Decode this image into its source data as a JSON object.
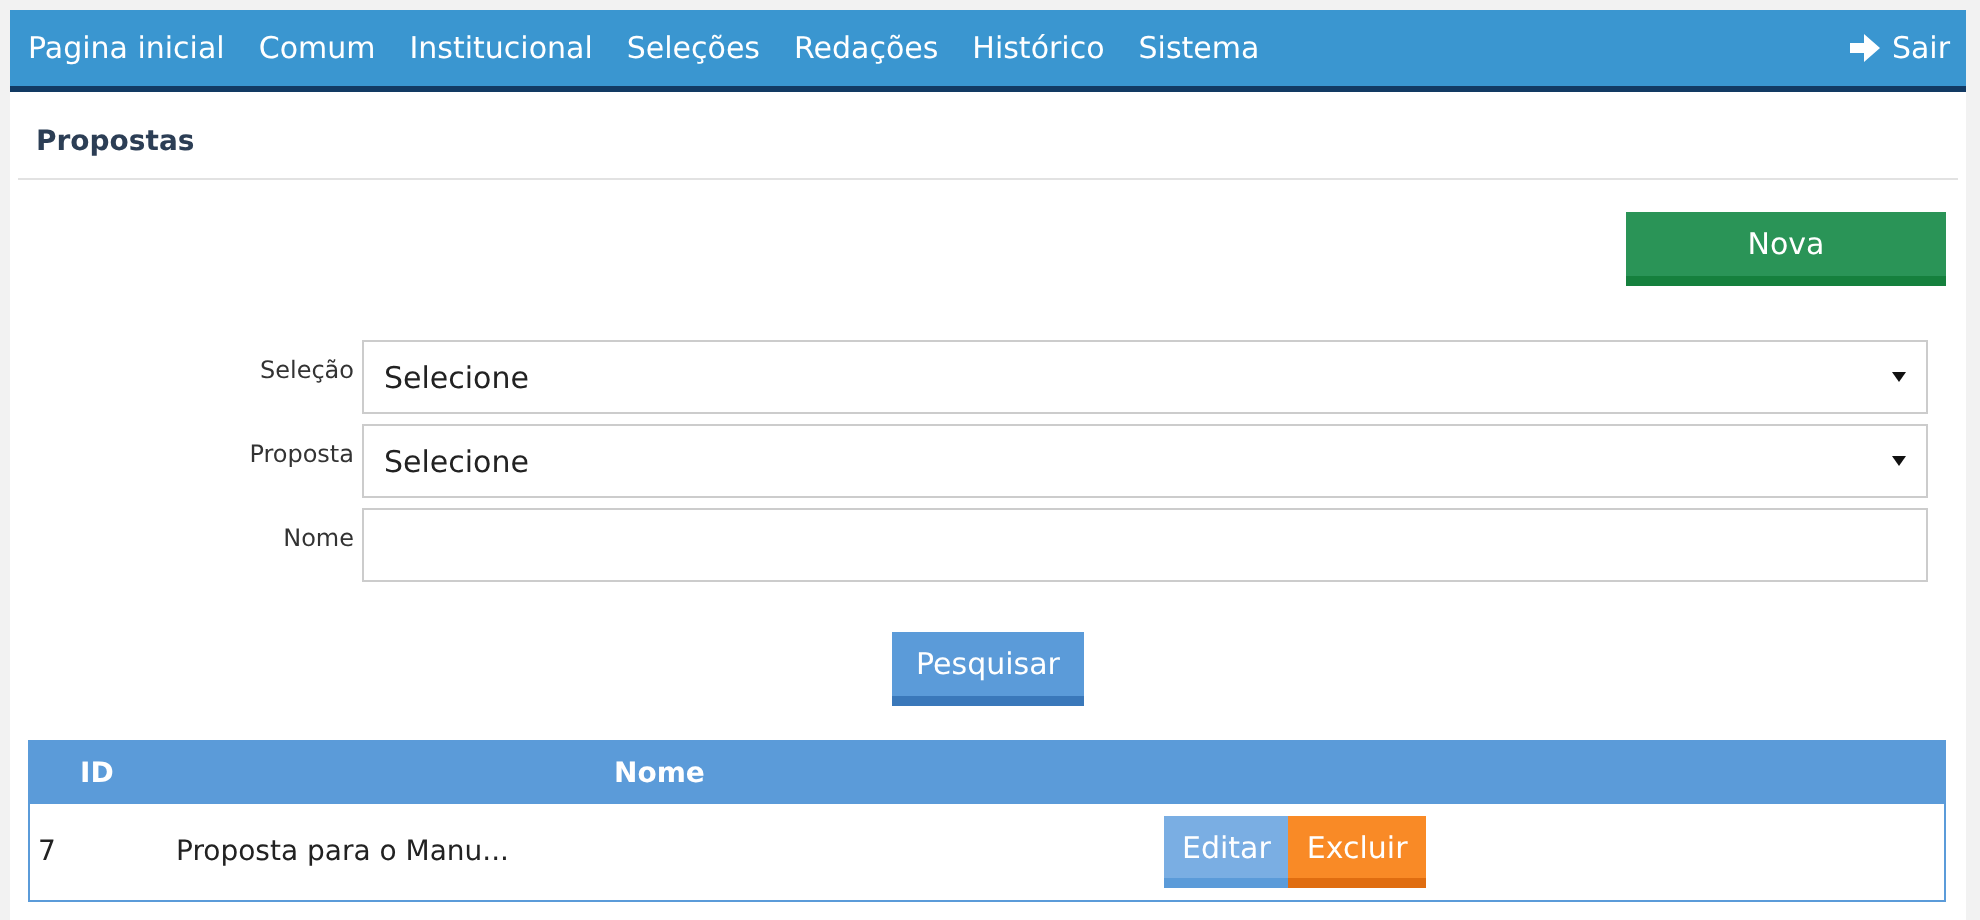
{
  "nav": {
    "items": [
      "Pagina inicial",
      "Comum",
      "Institucional",
      "Seleções",
      "Redações",
      "Histórico",
      "Sistema"
    ],
    "logout": "Sair"
  },
  "page_title": "Propostas",
  "new_button": "Nova",
  "filters": [
    {
      "label": "Seleção",
      "kind": "select",
      "value": "Selecione"
    },
    {
      "label": "Proposta",
      "kind": "select",
      "value": "Selecione"
    },
    {
      "label": "Nome",
      "kind": "text"
    }
  ],
  "search_button": "Pesquisar",
  "table": {
    "columns": [
      "ID",
      "Nome"
    ],
    "rows": [
      {
        "id": "7",
        "name": "Proposta para o Manu...",
        "actions": [
          "Editar",
          "Excluir"
        ]
      }
    ]
  }
}
